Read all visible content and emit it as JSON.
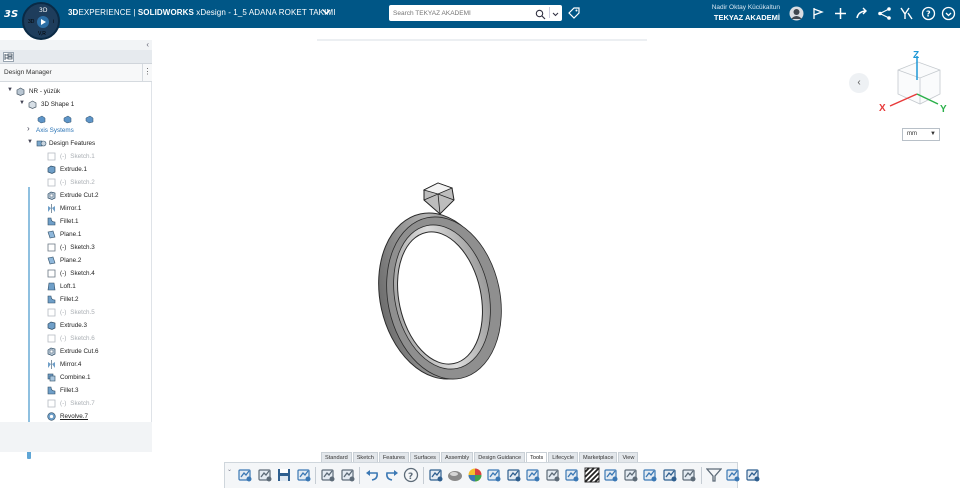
{
  "topbar": {
    "brand_3d": "3D",
    "brand_experience": "EXPERIENCE",
    "brand_sep": " | ",
    "brand_solidworks": "SOLIDWORKS",
    "app_name": " xDesign - 1_5 ADANA ROKET TAKIMI",
    "search_placeholder": "Search TEKYAZ AKADEMİ",
    "user_name": "Nadir Oktay Kücükaltun",
    "user_company": "TEKYAZ AKADEMİ",
    "compass": {
      "north": "3D",
      "west": "3D",
      "east": "i",
      "south": "V,R"
    }
  },
  "left_panel": {
    "tab_icon": "tree-icon",
    "title": "Design Manager",
    "menu": "⋮",
    "tree": [
      {
        "label": "NR - yüzük",
        "icon": "part-icon",
        "style": "normal"
      },
      {
        "label": "3D Shape 1",
        "icon": "shape-icon",
        "style": "normal"
      },
      {
        "label": "Axis Systems",
        "icon": "",
        "style": "link"
      },
      {
        "label": "Design Features",
        "icon": "features-icon",
        "style": "normal"
      },
      {
        "label": "Sketch.1",
        "icon": "sketch-icon",
        "style": "dim"
      },
      {
        "label": "Extrude.1",
        "icon": "extrude-icon",
        "style": "normal"
      },
      {
        "label": "Sketch.2",
        "icon": "sketch-icon",
        "style": "dim"
      },
      {
        "label": "Extrude Cut.2",
        "icon": "extrude-cut-icon",
        "style": "normal"
      },
      {
        "label": "Mirror.1",
        "icon": "mirror-icon",
        "style": "normal"
      },
      {
        "label": "Fillet.1",
        "icon": "fillet-icon",
        "style": "normal"
      },
      {
        "label": "Plane.1",
        "icon": "plane-icon",
        "style": "normal"
      },
      {
        "label": "Sketch.3",
        "icon": "sketch-icon",
        "style": "normal"
      },
      {
        "label": "Plane.2",
        "icon": "plane-icon",
        "style": "normal"
      },
      {
        "label": "Sketch.4",
        "icon": "sketch-icon",
        "style": "normal"
      },
      {
        "label": "Loft.1",
        "icon": "loft-icon",
        "style": "normal"
      },
      {
        "label": "Fillet.2",
        "icon": "fillet-icon",
        "style": "normal"
      },
      {
        "label": "Sketch.5",
        "icon": "sketch-icon",
        "style": "dim"
      },
      {
        "label": "Extrude.3",
        "icon": "extrude-icon",
        "style": "normal"
      },
      {
        "label": "Sketch.6",
        "icon": "sketch-icon",
        "style": "dim"
      },
      {
        "label": "Extrude Cut.6",
        "icon": "extrude-cut-icon",
        "style": "normal"
      },
      {
        "label": "Mirror.4",
        "icon": "mirror-icon",
        "style": "normal"
      },
      {
        "label": "Combine.1",
        "icon": "combine-icon",
        "style": "normal"
      },
      {
        "label": "Fillet.3",
        "icon": "fillet-icon",
        "style": "normal"
      },
      {
        "label": "Sketch.7",
        "icon": "sketch-icon",
        "style": "dim"
      },
      {
        "label": "Revolve.7",
        "icon": "revolve-icon",
        "style": "underline"
      }
    ],
    "sketch_prefix": "(-)"
  },
  "viewport": {
    "view_cube": {
      "z": "Z",
      "x": "X",
      "y": "Y"
    },
    "unit": "mm"
  },
  "action_bar": {
    "tabs": [
      "Standard",
      "Sketch",
      "Features",
      "Surfaces",
      "Assembly",
      "Design Guidance",
      "Tools",
      "Lifecycle",
      "Marketplace",
      "View"
    ],
    "active_tab": "Tools",
    "icons": [
      "section-view-icon",
      "measure-icon",
      "save-icon",
      "refresh-icon",
      "copy-icon",
      "settings-icon",
      "undo-icon",
      "redo-icon",
      "help-icon",
      "render-icon",
      "material-icon",
      "color-icon",
      "appearance-icon",
      "balance-icon",
      "inspect-icon",
      "gauge-icon",
      "draft-analysis-icon",
      "zebra-icon",
      "curvature-icon",
      "bounding-box-icon",
      "interference-icon",
      "mass-icon",
      "physical-icon",
      "filter-icon",
      "compare-icon",
      "export-icon"
    ]
  },
  "colors": {
    "topbar": "#005686",
    "accent": "#2a73b5",
    "ring_metal": "#8c8c8c",
    "view_cube_x": "#e83a3a",
    "view_cube_y": "#2bb04a",
    "view_cube_z": "#1f98d6"
  }
}
